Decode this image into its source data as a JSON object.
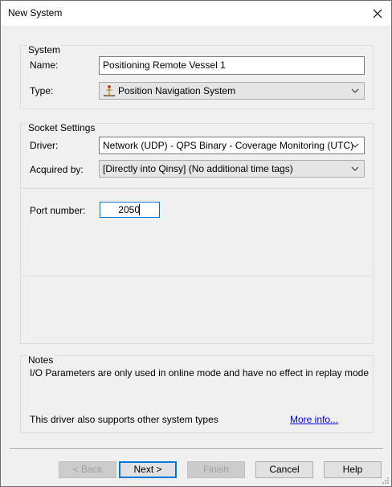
{
  "window": {
    "title": "New System"
  },
  "system": {
    "group_title": "System",
    "name_label": "Name:",
    "name_value": "Positioning Remote Vessel 1",
    "type_label": "Type:",
    "type_value": "Position Navigation System",
    "type_icon": "position-navigation-icon"
  },
  "socket": {
    "group_title": "Socket Settings",
    "driver_label": "Driver:",
    "driver_value": "Network (UDP) - QPS Binary - Coverage Monitoring (UTC)",
    "acquired_label": "Acquired by:",
    "acquired_value": "[Directly into Qinsy] (No additional time tags)",
    "port_label": "Port number:",
    "port_value": "2050"
  },
  "notes": {
    "group_title": "Notes",
    "text": "I/O Parameters are only used in online mode and have no effect in replay mode",
    "support_text": "This driver also supports other system types",
    "more_info": "More info..."
  },
  "buttons": {
    "back": "< Back",
    "next": "Next >",
    "finish": "Finish",
    "cancel": "Cancel",
    "help": "Help"
  }
}
